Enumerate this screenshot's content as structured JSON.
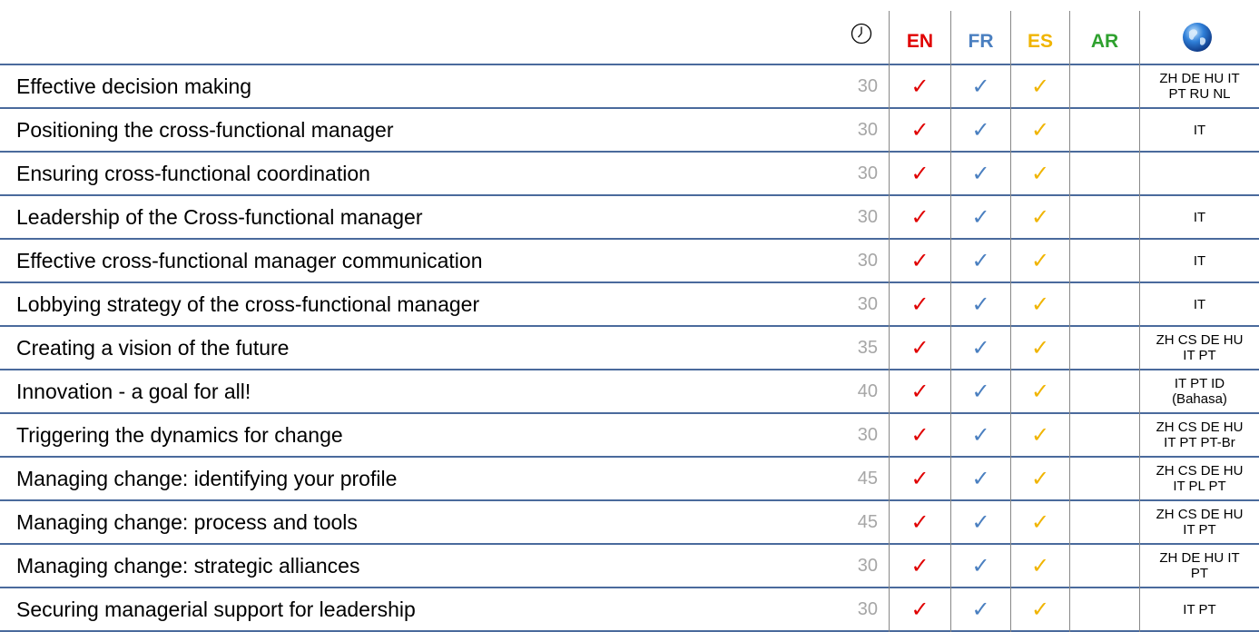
{
  "header": {
    "duration_icon": "clock-icon",
    "languages": [
      {
        "code": "EN",
        "color": "#e00000"
      },
      {
        "code": "FR",
        "color": "#4a7fc0"
      },
      {
        "code": "ES",
        "color": "#f0b400"
      },
      {
        "code": "AR",
        "color": "#2ea12e"
      }
    ],
    "other_languages_icon": "globe-icon"
  },
  "check_glyph": "✓",
  "courses": [
    {
      "title": "Effective decision making",
      "duration": "30",
      "en": "✓",
      "fr": "✓",
      "es": "✓",
      "ar": "",
      "other": "ZH DE HU IT\nPT RU NL"
    },
    {
      "title": "Positioning the cross-functional manager",
      "duration": "30",
      "en": "✓",
      "fr": "✓",
      "es": "✓",
      "ar": "",
      "other": "IT"
    },
    {
      "title": "Ensuring cross-functional coordination",
      "duration": "30",
      "en": "✓",
      "fr": "✓",
      "es": "✓",
      "ar": "",
      "other": ""
    },
    {
      "title": "Leadership of the Cross-functional manager",
      "duration": "30",
      "en": "✓",
      "fr": "✓",
      "es": "✓",
      "ar": "",
      "other": "IT"
    },
    {
      "title": "Effective cross-functional manager communication",
      "duration": "30",
      "en": "✓",
      "fr": "✓",
      "es": "✓",
      "ar": "",
      "other": "IT"
    },
    {
      "title": "Lobbying strategy of the cross-functional manager",
      "duration": "30",
      "en": "✓",
      "fr": "✓",
      "es": "✓",
      "ar": "",
      "other": "IT"
    },
    {
      "title": "Creating a vision of the future",
      "duration": "35",
      "en": "✓",
      "fr": "✓",
      "es": "✓",
      "ar": "",
      "other": "ZH CS DE HU\nIT PT"
    },
    {
      "title": "Innovation - a goal for all!",
      "duration": "40",
      "en": "✓",
      "fr": "✓",
      "es": "✓",
      "ar": "",
      "other": "IT PT ID\n(Bahasa)"
    },
    {
      "title": "Triggering the dynamics for change",
      "duration": "30",
      "en": "✓",
      "fr": "✓",
      "es": "✓",
      "ar": "",
      "other": "ZH CS DE HU\nIT PT PT-Br"
    },
    {
      "title": "Managing change: identifying your profile",
      "duration": "45",
      "en": "✓",
      "fr": "✓",
      "es": "✓",
      "ar": "",
      "other": "ZH CS DE HU\nIT PL PT"
    },
    {
      "title": "Managing change: process and tools",
      "duration": "45",
      "en": "✓",
      "fr": "✓",
      "es": "✓",
      "ar": "",
      "other": "ZH CS DE HU\nIT PT"
    },
    {
      "title": "Managing change: strategic alliances",
      "duration": "30",
      "en": "✓",
      "fr": "✓",
      "es": "✓",
      "ar": "",
      "other": "ZH DE HU IT\nPT"
    },
    {
      "title": "Securing managerial support for leadership",
      "duration": "30",
      "en": "✓",
      "fr": "✓",
      "es": "✓",
      "ar": "",
      "other": "IT PT"
    }
  ]
}
